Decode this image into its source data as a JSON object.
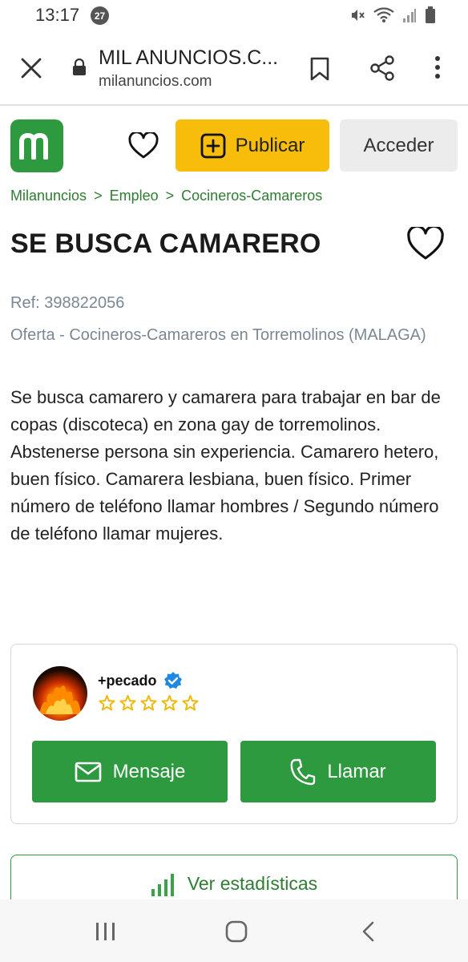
{
  "status_bar": {
    "time": "13:17",
    "notification_count": "27"
  },
  "browser": {
    "page_title": "MIL ANUNCIOS.C...",
    "url": "milanuncios.com"
  },
  "header": {
    "logo_letter": "m",
    "publish_label": "Publicar",
    "login_label": "Acceder"
  },
  "breadcrumb": {
    "items": [
      "Milanuncios",
      "Empleo",
      "Cocineros-Camareros"
    ],
    "separator": ">"
  },
  "ad": {
    "title": "SE BUSCA CAMARERO",
    "ref": "Ref: 398822056",
    "offer": "Oferta - Cocineros-Camareros en Torremolinos (MALAGA)",
    "description": "Se busca camarero y camarera para trabajar en bar de copas (discoteca) en zona gay de torremolinos. Abstenerse persona sin experiencia. Camarero hetero, buen físico. Camarera lesbiana, buen físico. Primer número de teléfono llamar hombres / Segundo número de teléfono llamar mujeres."
  },
  "seller": {
    "name": "+pecado",
    "rating_stars": 0,
    "rating_max": 5,
    "message_label": "Mensaje",
    "call_label": "Llamar"
  },
  "stats": {
    "label": "Ver estadísticas"
  },
  "colors": {
    "brand_green": "#2e9a3f",
    "link_green": "#2e7d32",
    "publish_yellow": "#f7bd0a",
    "star_yellow": "#f2b705",
    "verified_blue": "#1e88e5"
  },
  "icons": {
    "close": "close-icon",
    "lock": "lock-icon",
    "bookmark": "bookmark-icon",
    "share": "share-icon",
    "more": "more-vert-icon",
    "favorite": "heart-icon",
    "publish": "plus-square-icon",
    "verified": "verified-badge-icon",
    "star": "star-outline-icon",
    "mail": "mail-icon",
    "phone": "phone-icon",
    "stats": "bar-chart-icon"
  }
}
